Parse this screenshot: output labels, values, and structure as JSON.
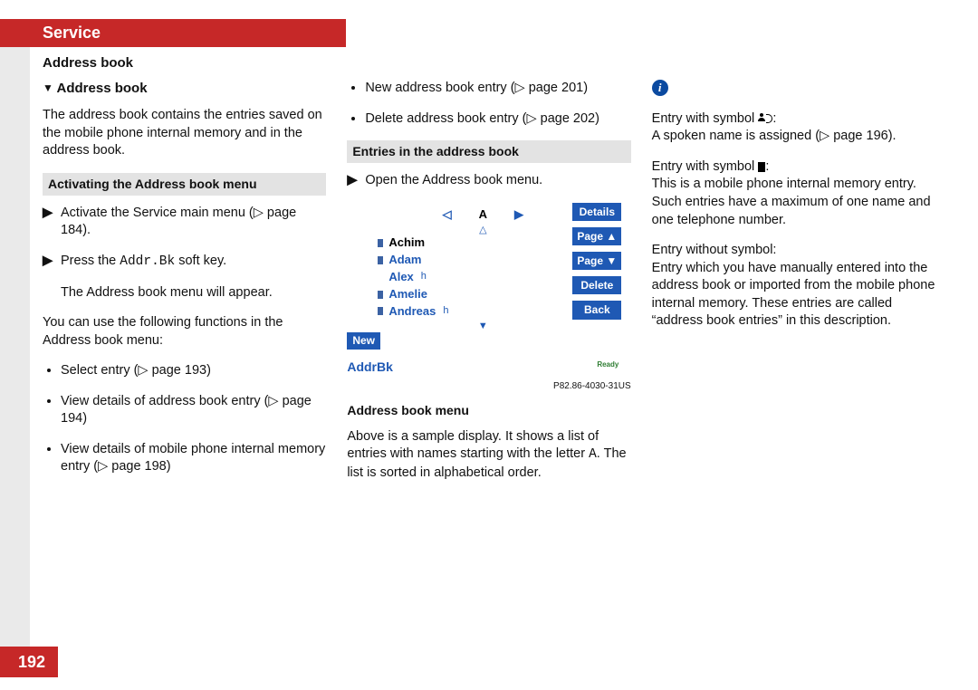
{
  "header": {
    "service": "Service",
    "title": "Address book"
  },
  "page_number": "192",
  "col1": {
    "subhead_marker": "▼",
    "subhead": "Address book",
    "intro": "The address book contains the entries saved on the mobile phone internal memory and in the address book.",
    "section1_title": "Activating the Address book menu",
    "step1": "Activate the Service main menu (▷ page 184).",
    "step2_pre": "Press the ",
    "step2_mono": "Addr.Bk",
    "step2_post": " soft key.",
    "step2_result": "The Address book menu will appear.",
    "functions_intro": "You can use the following functions in the Address book menu:",
    "b1": "Select entry (▷ page 193)",
    "b2": "View details of address book entry (▷ page 194)",
    "b3": "View details of mobile phone internal memory entry (▷ page 198)"
  },
  "col2": {
    "b4": "New address book entry (▷ page 201)",
    "b5": "Delete address book entry (▷ page 202)",
    "section2_title": "Entries in the address book",
    "step1": "Open the Address book menu.",
    "screen": {
      "left_arrow": "◁",
      "letter": "A",
      "right_arrow": "▶",
      "up": "△",
      "names": [
        "Achim",
        "Adam",
        "Alex",
        "Amelie",
        "Andreas"
      ],
      "h_marker": "h",
      "down": "▼",
      "new": "New",
      "addrbk": "AddrBk",
      "ready": "Ready",
      "softkeys": [
        "Details",
        "Page ▲",
        "Page ▼",
        "Delete",
        "Back"
      ],
      "partno": "P82.86-4030-31US",
      "caption": "Address book menu"
    },
    "sample_desc_pre": "Above is a sample display. It shows a list of entries with names starting with the letter ",
    "sample_desc_letter": "A",
    "sample_desc_post": ". The list is sorted in alphabetical order."
  },
  "col3": {
    "p1_pre": "Entry with symbol ",
    "p1_post": ":",
    "p1_body": "A spoken name is assigned (▷ page 196).",
    "p2_pre": "Entry with symbol ",
    "p2_post": ":",
    "p2_body": "This is a mobile phone internal memory entry. Such entries have a maximum of one name and one telephone number.",
    "p3_head": "Entry without symbol:",
    "p3_body": "Entry which you have manually entered into the address book or imported from the mobile phone internal memory. These entries are called “address book entries” in this description."
  }
}
